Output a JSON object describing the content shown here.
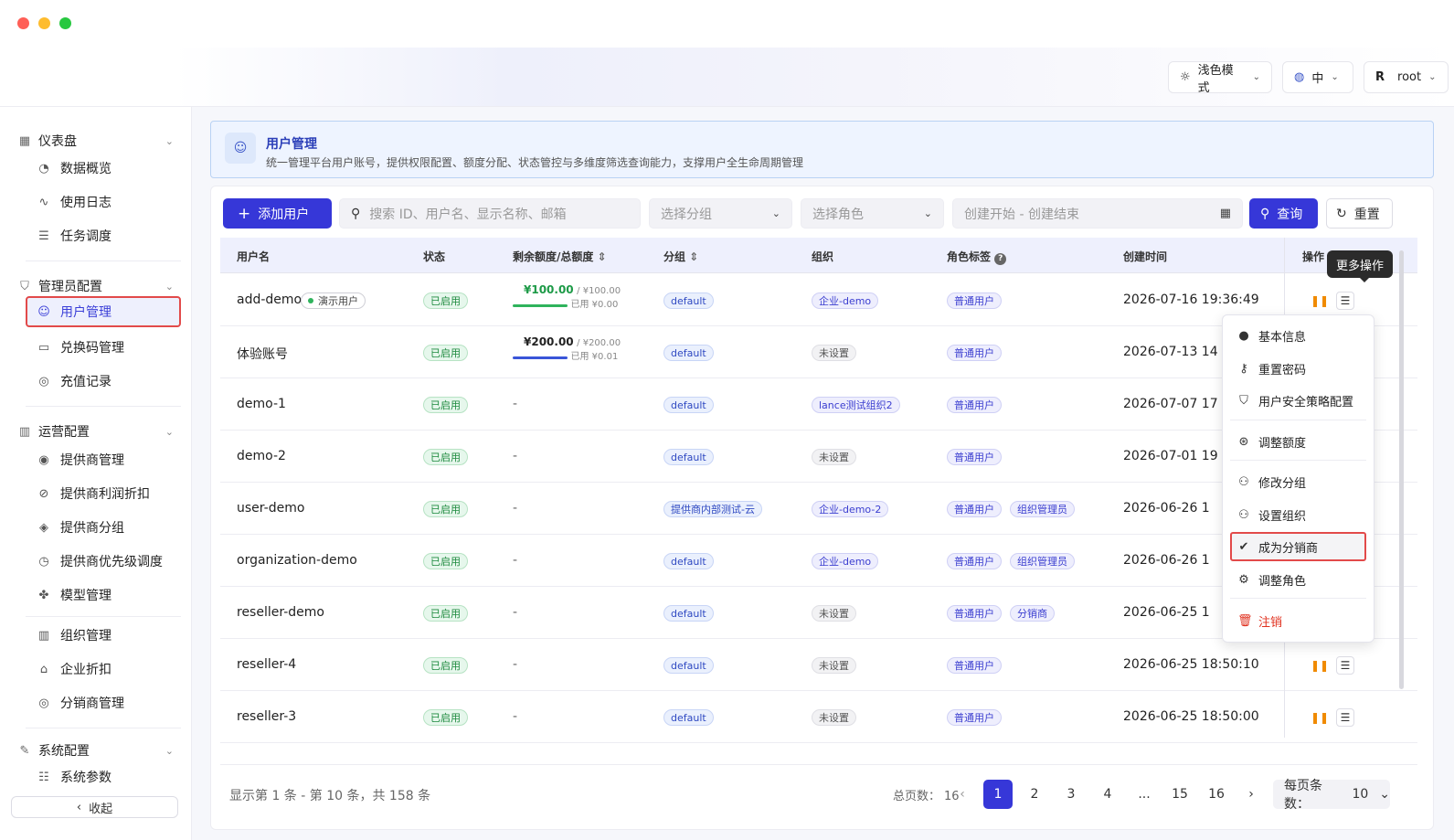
{
  "header": {
    "theme_label": "浅色模式",
    "lang_label": "中",
    "user_initial": "R",
    "user_name": "root"
  },
  "sidebar": {
    "sections": [
      {
        "label": "仪表盘",
        "items": [
          "数据概览",
          "使用日志",
          "任务调度"
        ]
      },
      {
        "label": "管理员配置",
        "items": [
          "用户管理",
          "兑换码管理",
          "充值记录"
        ]
      },
      {
        "label": "运营配置",
        "items": [
          "提供商管理",
          "提供商利润折扣",
          "提供商分组",
          "提供商优先级调度",
          "模型管理",
          "组织管理",
          "企业折扣",
          "分销商管理"
        ]
      },
      {
        "label": "系统配置",
        "items": [
          "系统参数"
        ]
      }
    ],
    "collapse_label": "收起"
  },
  "banner": {
    "title": "用户管理",
    "desc": "统一管理平台用户账号，提供权限配置、额度分配、状态管控与多维度筛选查询能力，支撑用户全生命周期管理"
  },
  "toolbar": {
    "add_label": "添加用户",
    "search_placeholder": "搜索 ID、用户名、显示名称、邮箱",
    "group_placeholder": "选择分组",
    "role_placeholder": "选择角色",
    "date_placeholder": "创建开始 - 创建结束",
    "query_label": "查询",
    "reset_label": "重置"
  },
  "table": {
    "headers": [
      "用户名",
      "状态",
      "剩余额度/总额度",
      "分组",
      "组织",
      "角色标签",
      "创建时间",
      "操作"
    ],
    "rows": [
      {
        "name": "add-demo",
        "tag": "演示用户",
        "status": "已启用",
        "quota": {
          "remain": "¥100.00",
          "total": "/ ¥100.00",
          "used": "已用 ¥0.00",
          "bar_color": "#2fb35c",
          "remain_color": "#1d9a47"
        },
        "group": "default",
        "org": "企业-demo",
        "org_set": true,
        "roles": [
          "普通用户"
        ],
        "created": "2026-07-16 19:36:49"
      },
      {
        "name": "体验账号",
        "tag": "",
        "status": "已启用",
        "quota": {
          "remain": "¥200.00",
          "total": "/ ¥200.00",
          "used": "已用 ¥0.01",
          "bar_color": "#3a55d8",
          "remain_color": "#222"
        },
        "group": "default",
        "org": "未设置",
        "org_set": false,
        "roles": [
          "普通用户"
        ],
        "created": "2026-07-13 14"
      },
      {
        "name": "demo-1",
        "tag": "",
        "status": "已启用",
        "quota": null,
        "group": "default",
        "org": "lance测试组织2",
        "org_set": true,
        "roles": [
          "普通用户"
        ],
        "created": "2026-07-07 17"
      },
      {
        "name": "demo-2",
        "tag": "",
        "status": "已启用",
        "quota": null,
        "group": "default",
        "org": "未设置",
        "org_set": false,
        "roles": [
          "普通用户"
        ],
        "created": "2026-07-01 19"
      },
      {
        "name": "user-demo",
        "tag": "",
        "status": "已启用",
        "quota": null,
        "group": "提供商内部测试-云",
        "org": "企业-demo-2",
        "org_set": true,
        "roles": [
          "普通用户",
          "组织管理员"
        ],
        "created": "2026-06-26 1"
      },
      {
        "name": "organization-demo",
        "tag": "",
        "status": "已启用",
        "quota": null,
        "group": "default",
        "org": "企业-demo",
        "org_set": true,
        "roles": [
          "普通用户",
          "组织管理员"
        ],
        "created": "2026-06-26 1"
      },
      {
        "name": "reseller-demo",
        "tag": "",
        "status": "已启用",
        "quota": null,
        "group": "default",
        "org": "未设置",
        "org_set": false,
        "roles": [
          "普通用户",
          "分销商"
        ],
        "created": "2026-06-25 1"
      },
      {
        "name": "reseller-4",
        "tag": "",
        "status": "已启用",
        "quota": null,
        "group": "default",
        "org": "未设置",
        "org_set": false,
        "roles": [
          "普通用户"
        ],
        "created": "2026-06-25 18:50:10"
      },
      {
        "name": "reseller-3",
        "tag": "",
        "status": "已启用",
        "quota": null,
        "group": "default",
        "org": "未设置",
        "org_set": false,
        "roles": [
          "普通用户"
        ],
        "created": "2026-06-25 18:50:00"
      }
    ],
    "empty_quota": "-"
  },
  "tooltip": "更多操作",
  "menu": {
    "items": [
      {
        "label": "基本信息",
        "icon": "user-icon"
      },
      {
        "label": "重置密码",
        "icon": "key-icon"
      },
      {
        "label": "用户安全策略配置",
        "icon": "shield-icon"
      },
      {
        "label": "调整额度",
        "icon": "dollar-circle-icon"
      },
      {
        "label": "修改分组",
        "icon": "group-icon"
      },
      {
        "label": "设置组织",
        "icon": "group-icon"
      },
      {
        "label": "成为分销商",
        "icon": "badge-check-icon"
      },
      {
        "label": "调整角色",
        "icon": "gear-icon"
      },
      {
        "label": "注销",
        "icon": "trash-icon"
      }
    ]
  },
  "pagination": {
    "info": "显示第 1 条 - 第 10 条，共 158 条",
    "total_label": "总页数：",
    "total_pages": "16",
    "pages": [
      "1",
      "2",
      "3",
      "4",
      "...",
      "15",
      "16"
    ],
    "current": "1",
    "size_label": "每页条数：",
    "size_value": "10"
  }
}
